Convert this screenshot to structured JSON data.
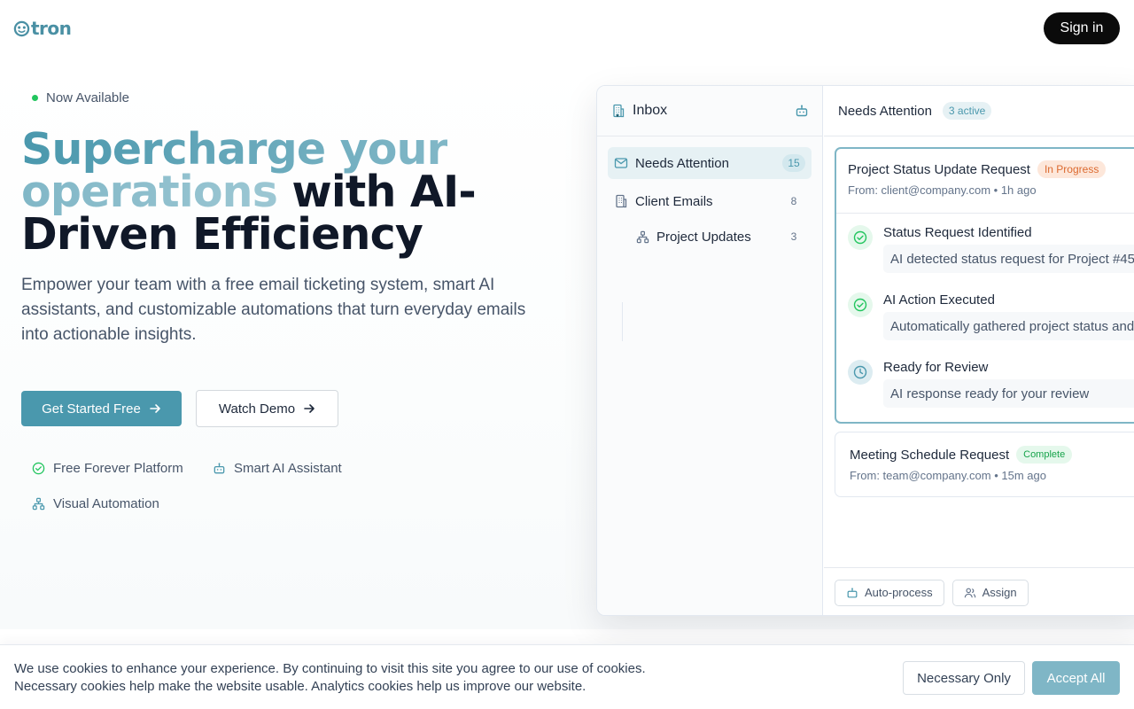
{
  "header": {
    "logo_text": "tron",
    "sign_in_label": "Sign in"
  },
  "hero": {
    "badge": "Now Available",
    "headline_accent": "Supercharge your operations",
    "headline_rest": " with AI-Driven Efficiency",
    "subtitle": "Empower your team with a free email ticketing system, smart AI assistants, and customizable automations that turn everyday emails into actionable insights.",
    "cta_primary": "Get Started Free",
    "cta_secondary": "Watch Demo",
    "features": [
      "Free Forever Platform",
      "Smart AI Assistant",
      "Visual Automation"
    ]
  },
  "inbox": {
    "title": "Inbox",
    "nav": [
      {
        "label": "Needs Attention",
        "count": "15"
      },
      {
        "label": "Client Emails",
        "count": "8"
      },
      {
        "label": "Project Updates",
        "count": "3"
      }
    ],
    "main_title": "Needs Attention",
    "active_badge": "3 active",
    "tickets": [
      {
        "title": "Project Status Update Request",
        "status": "In Progress",
        "from": "From: client@company.com • 1h ago",
        "steps": [
          {
            "title": "Status Request Identified",
            "detail": "AI detected status request for Project #45"
          },
          {
            "title": "AI Action Executed",
            "detail": "Automatically gathered project status and"
          },
          {
            "title": "Ready for Review",
            "detail": "AI response ready for your review"
          }
        ]
      },
      {
        "title": "Meeting Schedule Request",
        "status": "Complete",
        "from": "From: team@company.com • 15m ago"
      }
    ],
    "actions": [
      "Auto-process",
      "Assign"
    ]
  },
  "cookie": {
    "line1": "We use cookies to enhance your experience. By continuing to visit this site you agree to our use of cookies.",
    "line2": "Necessary cookies help make the website usable. Analytics cookies help us improve our website.",
    "necessary_label": "Necessary Only",
    "accept_label": "Accept All"
  },
  "colors": {
    "brand": "#4a98ad",
    "brand_light": "#7fb6c6",
    "status_in_progress": "#dc6a30",
    "status_complete": "#16a34a",
    "available_dot": "#22c55e"
  }
}
